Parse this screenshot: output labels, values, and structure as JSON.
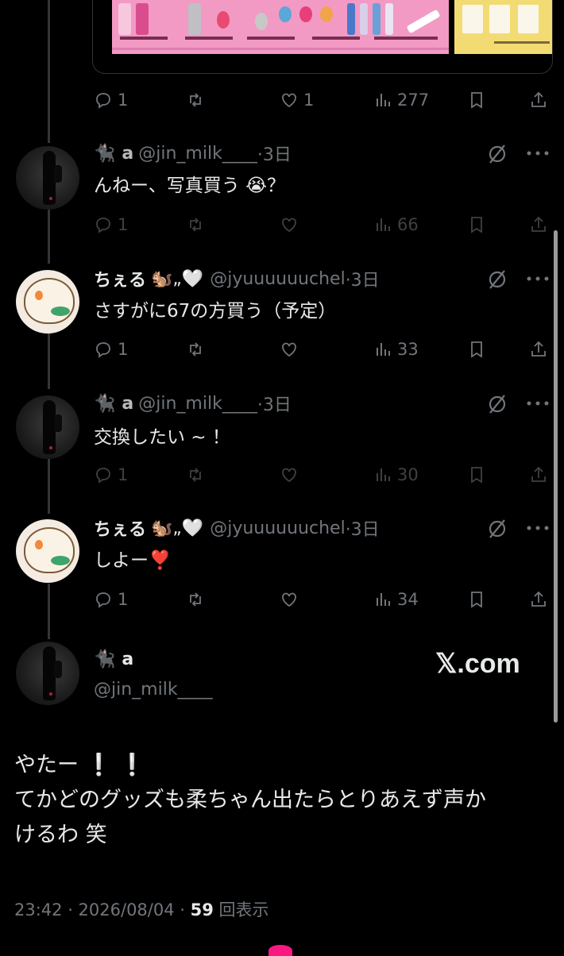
{
  "colors": {
    "background": "#000000",
    "text": "#e7e9ea",
    "muted": "#71767b",
    "like_pink": "#f91880"
  },
  "top_post": {
    "replies": "1",
    "retweets": "",
    "likes": "1",
    "views": "277"
  },
  "replies": [
    {
      "author": {
        "emoji": "🐈‍⬛",
        "name": "a",
        "handle": "@jin_milk____",
        "avatar": "dark-figure-avatar"
      },
      "time": "·3日",
      "text": "んねー、写真買う 😭？",
      "stats": {
        "replies": "1",
        "retweets": "",
        "likes": "",
        "views": "66"
      },
      "dimmed": true
    },
    {
      "author": {
        "name": "ちぇる",
        "name_emoji": "🐿️„🤍",
        "handle": "@jyuuuuuuchel",
        "avatar": "rowlet-avatar"
      },
      "time": "·3日",
      "text": "さすがに67の方買う（予定）",
      "stats": {
        "replies": "1",
        "retweets": "",
        "likes": "",
        "views": "33"
      },
      "dimmed": false
    },
    {
      "author": {
        "emoji": "🐈‍⬛",
        "name": "a",
        "handle": "@jin_milk____",
        "avatar": "dark-figure-avatar"
      },
      "time": "·3日",
      "text": "交換したい ~ ！",
      "stats": {
        "replies": "1",
        "retweets": "",
        "likes": "",
        "views": "30"
      },
      "dimmed": true
    },
    {
      "author": {
        "name": "ちぇる",
        "name_emoji": "🐿️„🤍",
        "handle": "@jyuuuuuuchel",
        "avatar": "rowlet-avatar"
      },
      "time": "·3日",
      "text": "しよー❣️",
      "stats": {
        "replies": "1",
        "retweets": "",
        "likes": "",
        "views": "34"
      },
      "dimmed": false
    }
  ],
  "main_post": {
    "author": {
      "emoji": "🐈‍⬛",
      "name": "a",
      "handle": "@jin_milk____"
    },
    "watermark": "𝕏.com",
    "text_line1": "やたー ❕ ❕",
    "text_line2": "てかどのグッズも柔ちゃん出たらとりあえず声か",
    "text_line3": "けるわ 笑",
    "time": "23:42 · 2026/08/04 · ",
    "views_count": "59",
    "views_label": " 回表示"
  }
}
